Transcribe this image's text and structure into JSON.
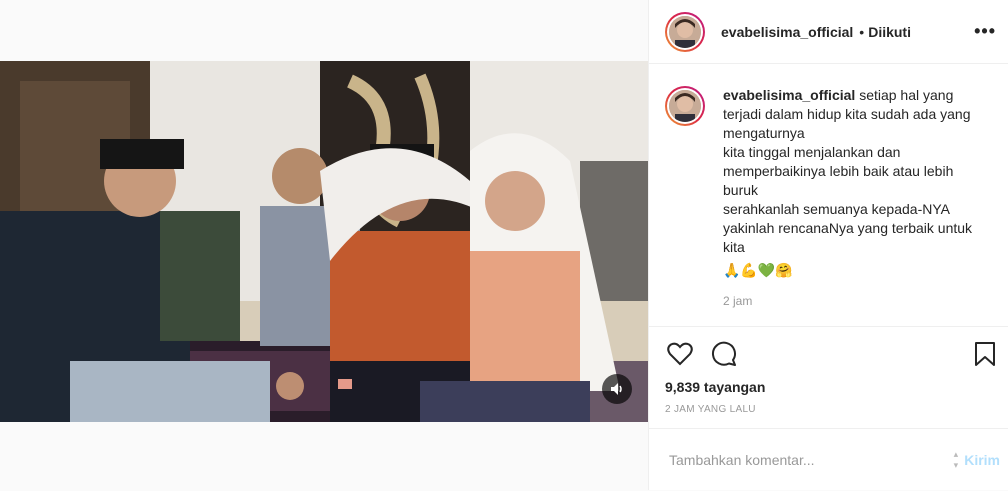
{
  "header": {
    "username": "evabelisima_official",
    "separator": "•",
    "follow_label": "Diikuti",
    "more_label": "•••"
  },
  "caption": {
    "username": "evabelisima_official",
    "lines": [
      "setiap hal yang terjadi dalam hidup kita sudah ada yang mengaturnya",
      "kita tinggal menjalankan dan memperbaikinya lebih baik atau lebih buruk",
      "serahkanlah semuanya kepada-NYA",
      "yakinlah rencanaNya yang terbaik untuk kita"
    ],
    "emojis": "🙏💪💚🤗",
    "time": "2 jam"
  },
  "stats": {
    "views": "9,839 tayangan",
    "posted": "2 JAM YANG LALU"
  },
  "comment": {
    "placeholder": "Tambahkan komentar...",
    "send_label": "Kirim"
  },
  "icons": {
    "like": "heart-icon",
    "comment": "comment-icon",
    "save": "bookmark-icon",
    "mute": "speaker-icon"
  }
}
